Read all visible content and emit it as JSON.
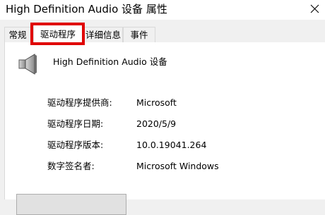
{
  "window": {
    "title": "High Definition Audio 设备 属性"
  },
  "tabs": [
    {
      "label": "常规",
      "active": false
    },
    {
      "label": "驱动程序",
      "active": true
    },
    {
      "label": "详细信息",
      "active": false
    },
    {
      "label": "事件",
      "active": false
    }
  ],
  "device": {
    "icon": "speaker-icon",
    "name": "High Definition Audio 设备"
  },
  "driver_info": [
    {
      "label": "驱动程序提供商:",
      "value": "Microsoft"
    },
    {
      "label": "驱动程序日期:",
      "value": "2020/5/9"
    },
    {
      "label": "驱动程序版本:",
      "value": "10.0.19041.264"
    },
    {
      "label": "数字签名者:",
      "value": "Microsoft Windows"
    }
  ],
  "colors": {
    "highlight": "#e00000",
    "panel_background": "#ffffff",
    "dialog_background": "#f0f0f0"
  }
}
